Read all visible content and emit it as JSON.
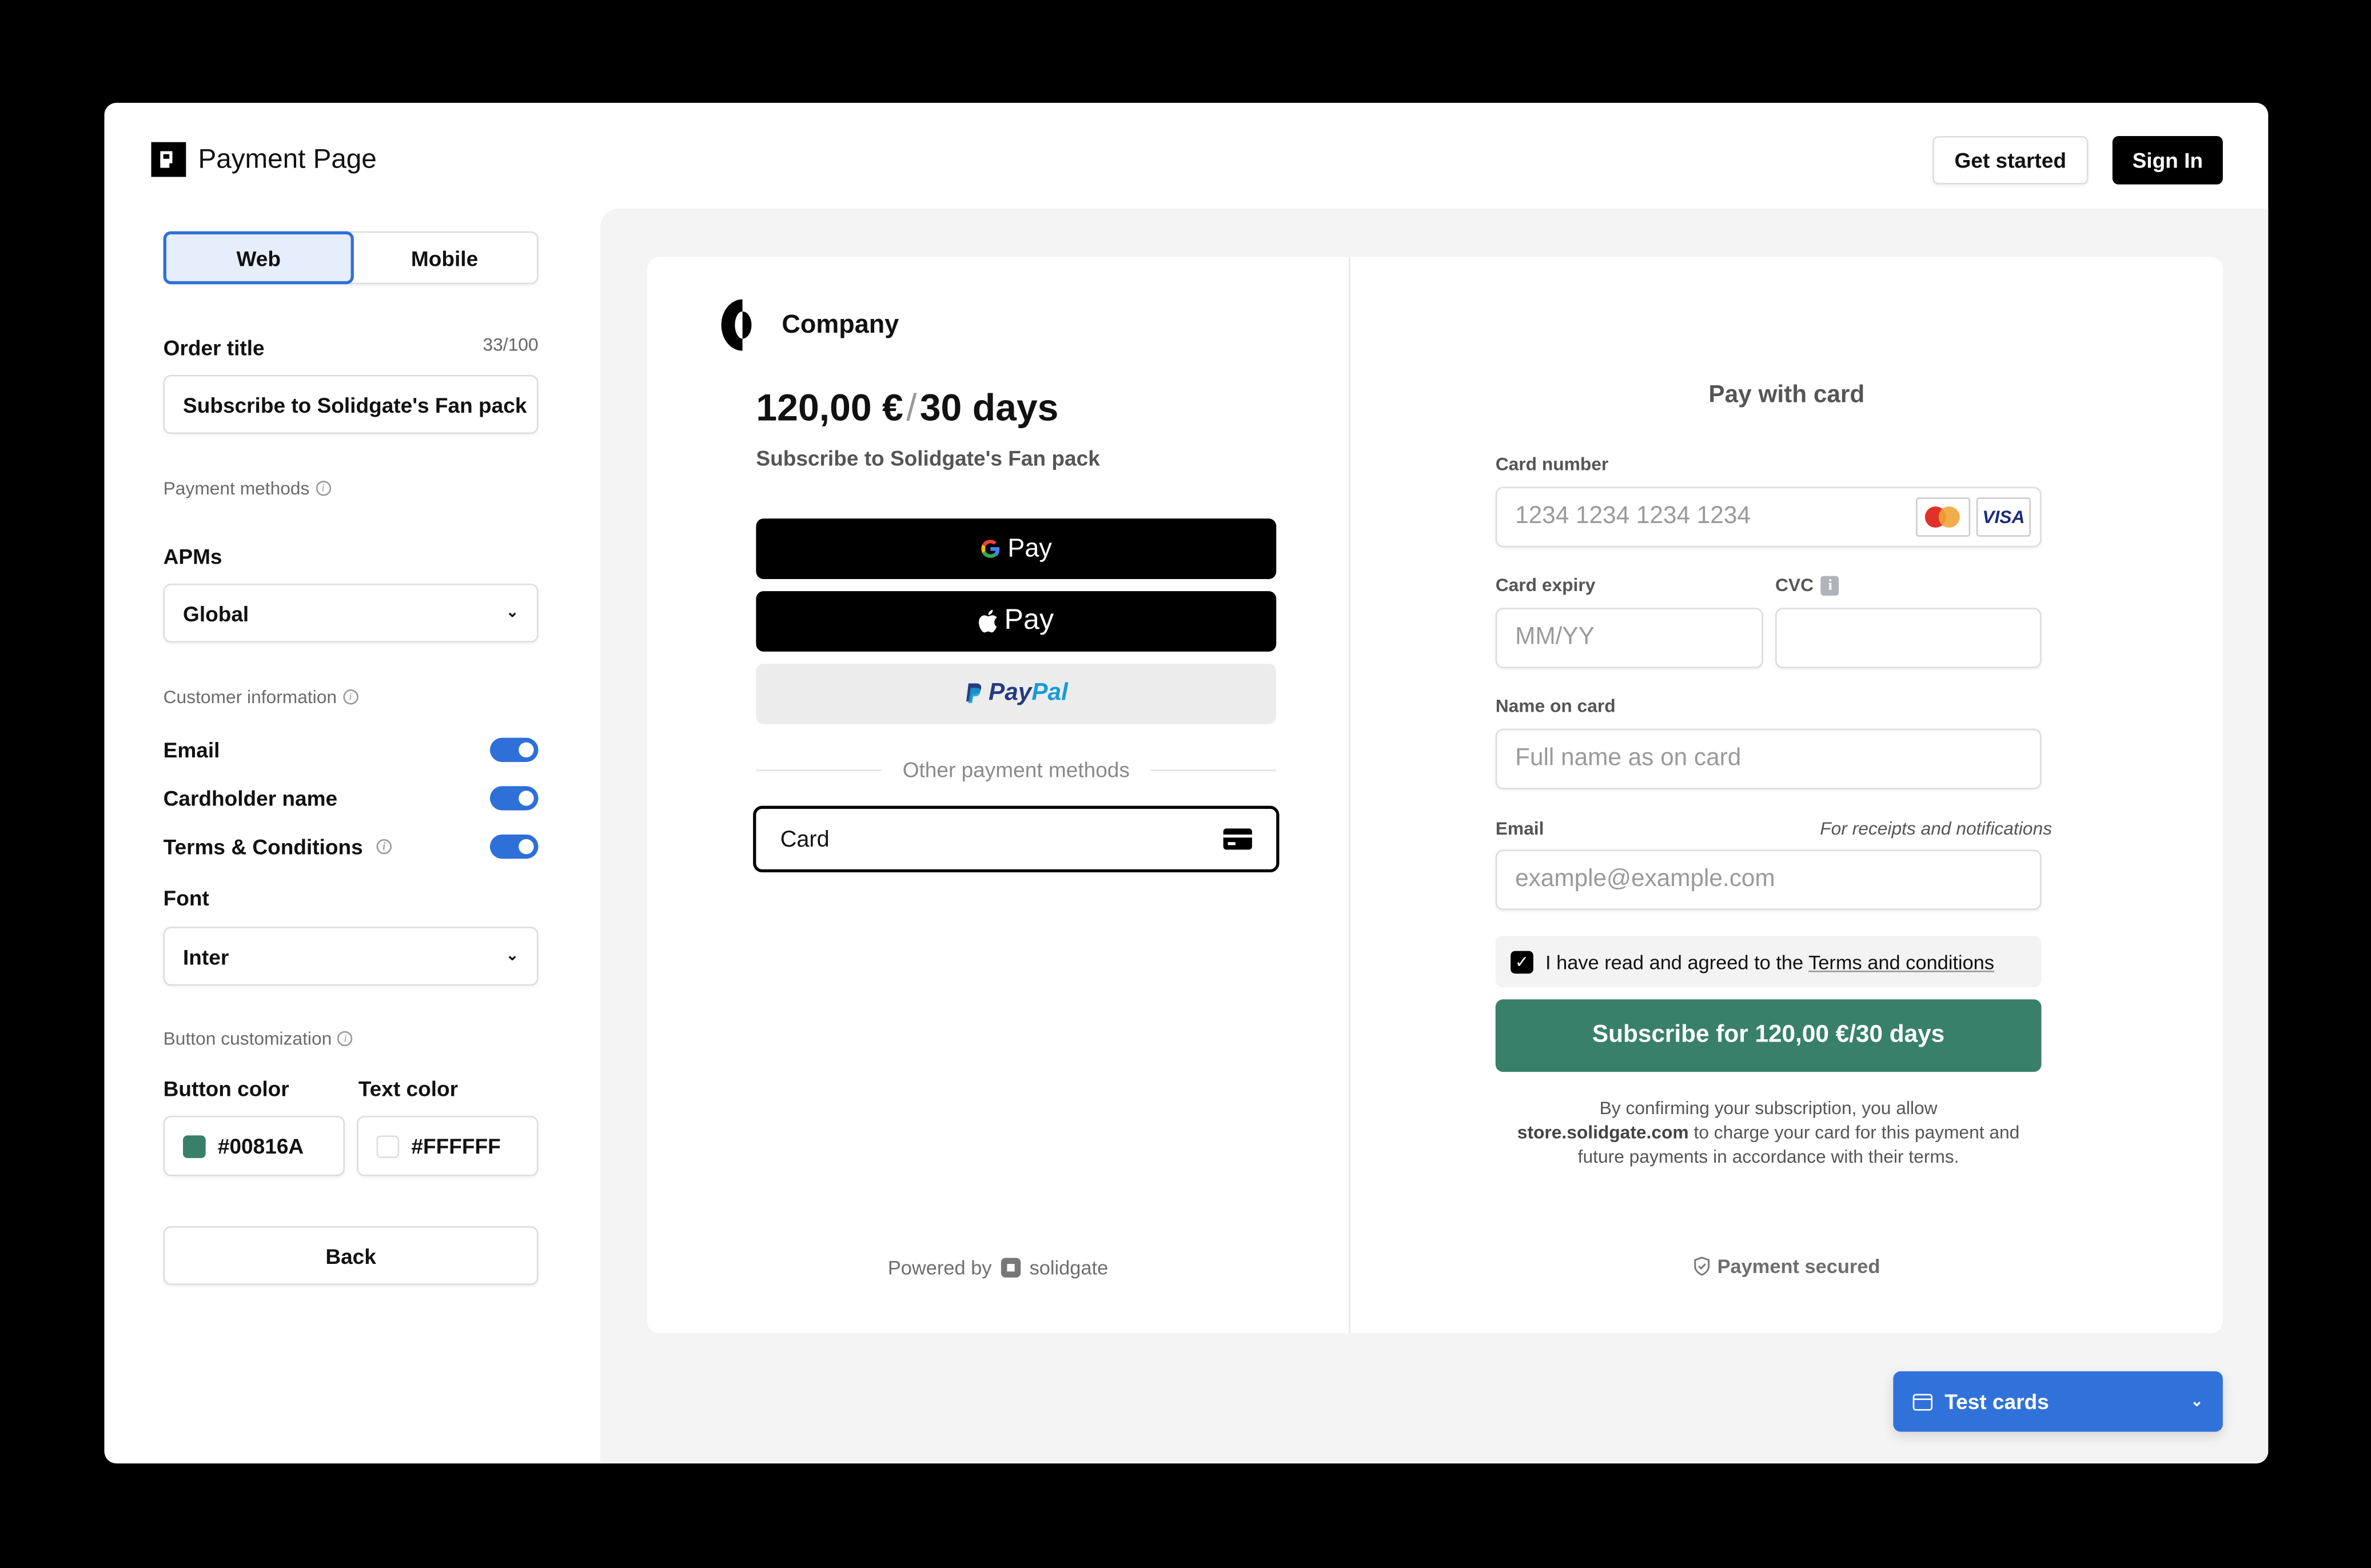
{
  "app": {
    "title": "Payment Page",
    "header_buttons": {
      "get_started": "Get started",
      "sign_in": "Sign In"
    }
  },
  "sidebar": {
    "view_tabs": [
      {
        "label": "Web",
        "active": true
      },
      {
        "label": "Mobile",
        "active": false
      }
    ],
    "order_title": {
      "label": "Order title",
      "counter": "33/100",
      "value": "Subscribe to Solidgate's Fan pack"
    },
    "payment_methods": {
      "section_label": "Payment methods",
      "apms_label": "APMs",
      "apms_value": "Global"
    },
    "customer_info": {
      "section_label": "Customer information",
      "toggles": [
        {
          "label": "Email",
          "on": true
        },
        {
          "label": "Cardholder name",
          "on": true
        },
        {
          "label": "Terms & Conditions",
          "on": true,
          "has_info": true
        }
      ]
    },
    "font": {
      "label": "Font",
      "value": "Inter"
    },
    "button_customization": {
      "section_label": "Button customization",
      "button_color_label": "Button color",
      "button_color_value": "#00816A",
      "text_color_label": "Text color",
      "text_color_value": "#FFFFFF"
    },
    "back_label": "Back"
  },
  "preview": {
    "company_name": "Company",
    "price": "120,00 €",
    "period": "30 days",
    "price_slash": "/",
    "order_subtitle": "Subscribe to Solidgate's Fan pack",
    "wallets": {
      "google_pay": "Pay",
      "apple_pay": "Pay",
      "paypal_pay": "Pay",
      "paypal_pal": "Pal"
    },
    "other_methods_label": "Other payment methods",
    "card_option_label": "Card",
    "powered_by": "Powered by",
    "powered_brand": "solidgate",
    "form": {
      "title": "Pay with card",
      "card_number_label": "Card number",
      "card_number_placeholder": "1234 1234 1234 1234",
      "card_brands": [
        "mastercard",
        "VISA"
      ],
      "expiry_label": "Card expiry",
      "expiry_placeholder": "MM/YY",
      "cvc_label": "CVC",
      "cvc_placeholder": "",
      "name_label": "Name on card",
      "name_placeholder": "Full name as on card",
      "email_label": "Email",
      "email_hint": "For receipts and notifications",
      "email_placeholder": "example@example.com",
      "terms_checked": true,
      "terms_text": "I have read and agreed to the",
      "terms_link": "Terms and conditions",
      "subscribe_label": "Subscribe for 120,00 €/30 days",
      "disclaimer_pre": "By confirming your subscription, you allow",
      "disclaimer_domain": "store.solidgate.com",
      "disclaimer_post": "to charge your card for this payment and future payments in accordance with their terms.",
      "secured_label": "Payment secured"
    },
    "test_cards_label": "Test cards"
  },
  "colors": {
    "accent_blue": "#2F6FD8",
    "subscribe_button": "#38806A",
    "button_color_swatch": "#38806A",
    "text_color_swatch": "#FFFFFF"
  }
}
